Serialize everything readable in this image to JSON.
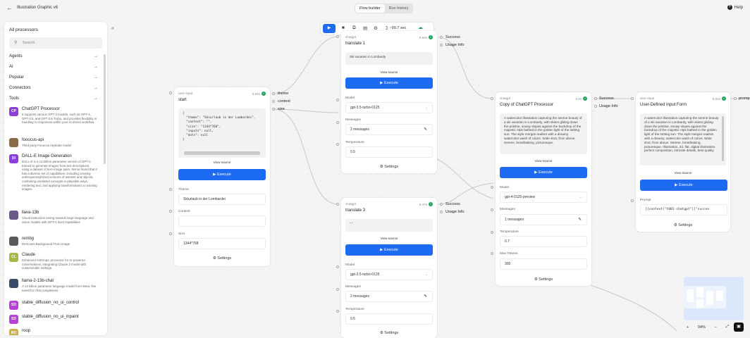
{
  "app": {
    "title": "Illustration Graphic v6",
    "tabs": [
      {
        "label": "Flow builder"
      },
      {
        "label": "Run history"
      }
    ],
    "help": "Help"
  },
  "sidebar": {
    "title": "All processors",
    "search_placeholder": "Search",
    "categories": [
      {
        "label": "Agents"
      },
      {
        "label": "AI"
      },
      {
        "label": "Popular"
      },
      {
        "label": "Connectors"
      },
      {
        "label": "Tools"
      }
    ],
    "processors": [
      {
        "initials": "CP",
        "name": "ChatGPT Processor",
        "desc": "It supports various GPT-3 models, such as GPT-4, GPT-3.5, and GPT-3.5 Turbo, and provides flexibility in handling AI responses within your AI-driven workflow.",
        "color": "#8b3fd9"
      },
      {
        "initials": "",
        "name": "fooocus-api",
        "desc": "Third party Fooocus replicate model",
        "color": "#8a6a4a"
      },
      {
        "initials": "DI",
        "name": "DALL-E Image Generation",
        "desc": "DALL-E is a 12-billion parameter version of GPT-3 trained to generate images from text descriptions, using a dataset of text–image pairs. We've found that it has a diverse set of capabilities, including creating anthropomorphized versions of animals and objects, combining unrelated concepts in plausible ways, rendering text, and applying transformations to existing images.",
        "color": "#8b3fd9"
      },
      {
        "initials": "",
        "name": "llava-13b",
        "desc": "Visual instruction tuning towards large language and vision models with GPT-4 level capabilities",
        "color": "#6a5a8a"
      },
      {
        "initials": "",
        "name": "rembg",
        "desc": "Removes Background From Image",
        "color": "#5a5a5a"
      },
      {
        "initials": "CL",
        "name": "Claude",
        "desc": "Enhanced Anthropic processor for AI-powered conversations, integrating Claude 2 model with customizable settings.",
        "color": "#a3b93f"
      },
      {
        "initials": "",
        "name": "llama-2-13b-chat",
        "desc": "A 13 billion parameter language model from Meta, fine tuned for chat completions",
        "color": "#3a4a6a"
      },
      {
        "initials": "SD",
        "name": "stable_diffusion_no_ui_control",
        "desc": "",
        "color": "#b83fd9"
      },
      {
        "initials": "SD",
        "name": "stable_diffusion_no_ui_inpaint",
        "desc": "",
        "color": "#b83fd9"
      },
      {
        "initials": "RO",
        "name": "roop",
        "desc": "",
        "color": "#c7b43f"
      }
    ]
  },
  "toolbar": {
    "time": "~99.7 sec"
  },
  "nodes": {
    "start": {
      "kind": "user-input",
      "title": "start",
      "duration": "0.04s",
      "code": "{\n  \"theme\": \"Skiurlaub in der Lombardei\",\n  \"context\": \"\",\n  \"size\": \"1344*768\",\n  \"inputs\": null,\n  \"dots\": null\n}",
      "view_source": "View source",
      "execute": "Execute",
      "theme_label": "Theme",
      "theme_value": "Skiurlaub in der Lombardei",
      "context_label": "Context",
      "context_value": "",
      "size_label": "Size",
      "size_value": "1344*768",
      "settings": "Settings",
      "outputs": [
        {
          "label": "theme"
        },
        {
          "label": "context"
        },
        {
          "label": "size"
        }
      ]
    },
    "t1": {
      "kind": "chatgpt",
      "title": "translate 1",
      "duration": "0.62s",
      "output": "Ski vacation in Lombardy",
      "view_source": "View source",
      "execute": "Execute",
      "model_label": "Model",
      "model_value": "gpt-3.5-turbo-0125",
      "messages_label": "Messages",
      "messages_value": "2 messages",
      "temp_label": "Temperature",
      "temp_value": "0.5",
      "settings": "Settings",
      "outputs": [
        {
          "label": "Success"
        },
        {
          "label": "Usage Info"
        }
      ]
    },
    "t3": {
      "kind": "chatgpt",
      "title": "translate 3",
      "duration": "0.47s",
      "output": "\".\"",
      "view_source": "View source",
      "execute": "Execute",
      "model_label": "Model",
      "model_value": "gpt-3.5-turbo-0125",
      "messages_label": "Messages",
      "messages_value": "2 messages",
      "temp_label": "Temperature",
      "temp_value": "0.5",
      "settings": "Settings",
      "outputs": [
        {
          "label": "Success"
        },
        {
          "label": "Usage Info"
        }
      ]
    },
    "copy": {
      "kind": "chatgpt",
      "title": "Copy of ChatGPT Processor",
      "duration": "4.2s",
      "output": "A watercolor illustration capturing the serene beauty of a ski vacation in Lombardy, with skiers gliding down the pristine, snowy slopes against the backdrop of the majestic Alps bathed in the golden light of the setting sun. The style merges realism with a dreamy, watercolor wash of colors. Wide shot, from above. Serene, breathtaking, picturesque.",
      "view_source": "View source",
      "execute": "Execute",
      "model_label": "Model",
      "model_value": "gpt-4-0125-preview",
      "messages_label": "Messages",
      "messages_value": "1 messages",
      "temp_label": "Temperature",
      "temp_value": "0.7",
      "maxtok_label": "Max Tokens",
      "maxtok_value": "300",
      "settings": "Settings",
      "outputs": [
        {
          "label": "Success"
        },
        {
          "label": "Usage Info"
        }
      ]
    },
    "udf": {
      "kind": "user-input",
      "title": "User-Defined Input Form",
      "duration": "0.02s",
      "output": "A watercolor illustration capturing the serene beauty of a ski vacation in Lombardy, with skiers gliding down the pristine, snowy slopes against the backdrop of the majestic Alps bathed in the golden light of the setting sun. The style merges realism with a dreamy, watercolor wash of colors. Wide shot, from above. Serene, breathtaking, picturesque. Illustration, 2d, flat, digital illustration, perfect composition, intricate details, best quality",
      "view_source": "View source",
      "execute": "Execute",
      "prompt_label": "Prompt",
      "prompt_value": "[{context[\"t0B1-chatgpt\"][\"succes",
      "settings": "Settings",
      "outputs": [
        {
          "label": "promp"
        }
      ]
    }
  },
  "zoom": {
    "level": "94%"
  }
}
